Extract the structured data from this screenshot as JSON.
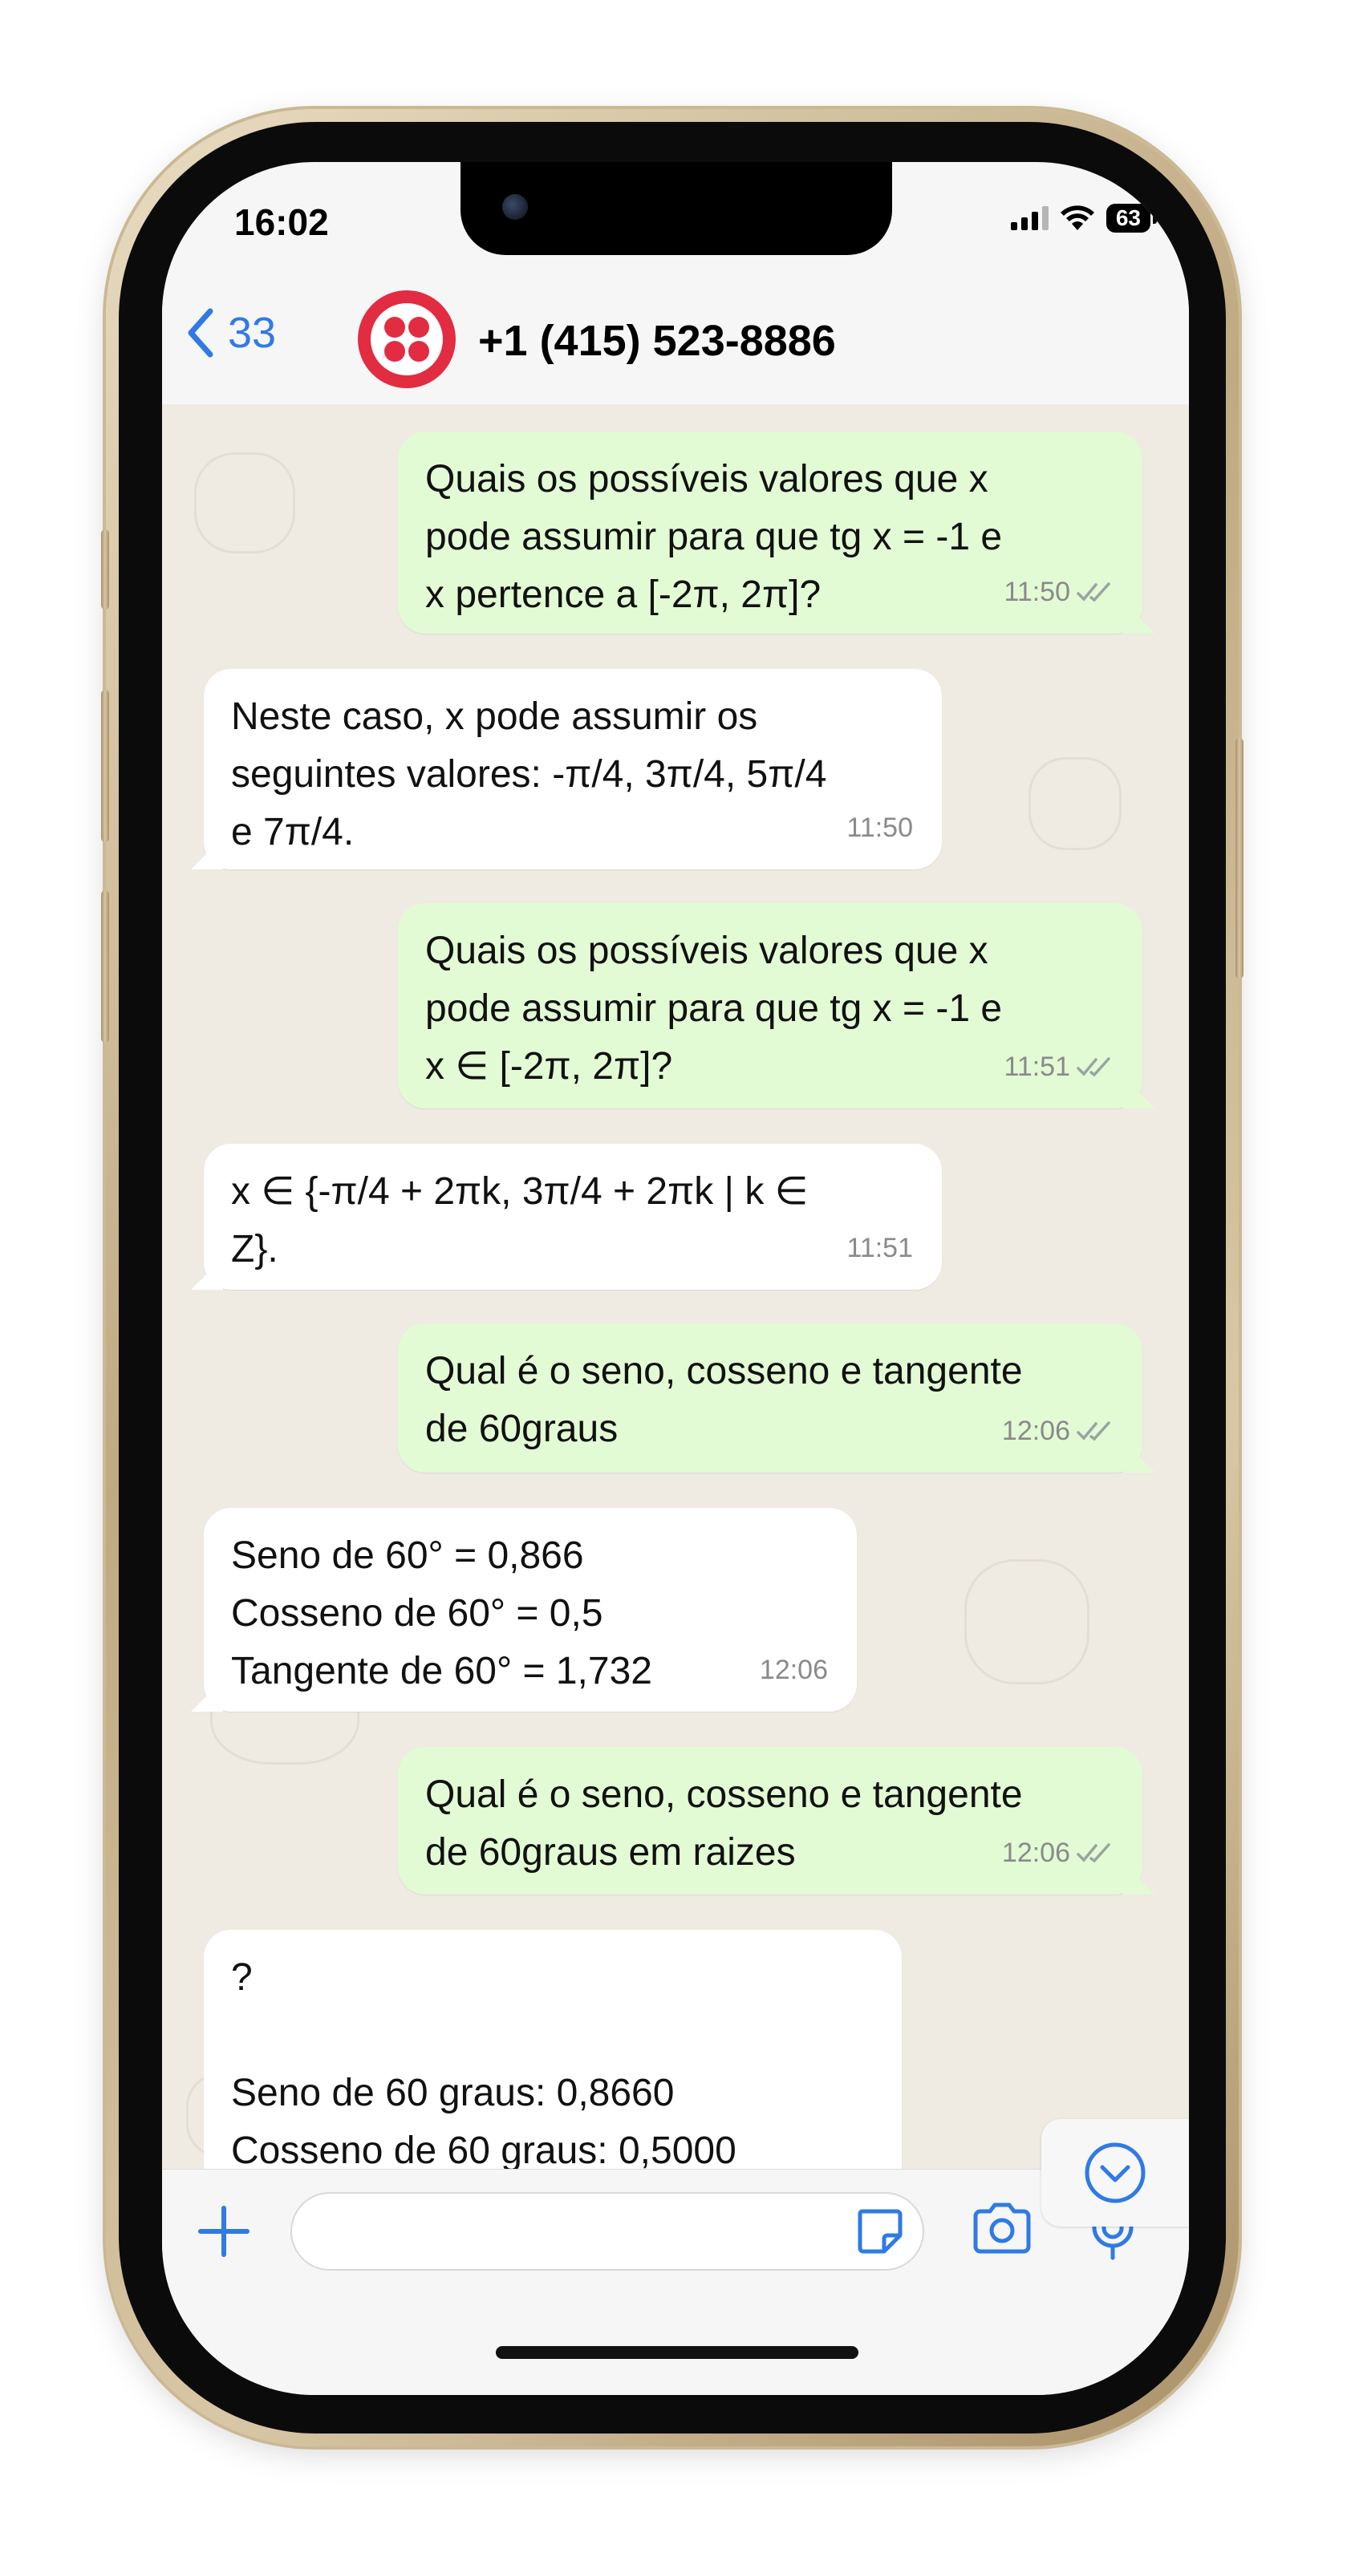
{
  "status_bar": {
    "time": "16:02",
    "battery": "63"
  },
  "header": {
    "back_count": "33",
    "contact_name": "+1 (415) 523-8886"
  },
  "messages": [
    {
      "dir": "out",
      "text": "Quais os possíveis valores que x\npode assumir para que tg x = -1 e\nx pertence a [-2π, 2π]?",
      "time": "11:50"
    },
    {
      "dir": "in",
      "text": "Neste caso, x pode assumir os\nseguintes valores: -π/4, 3π/4, 5π/4\ne 7π/4.",
      "time": "11:50"
    },
    {
      "dir": "out",
      "text": "Quais os possíveis valores que x\npode assumir para que tg x = -1 e\nx ∈ [-2π, 2π]?",
      "time": "11:51"
    },
    {
      "dir": "in",
      "text": "x ∈ {-π/4 + 2πk, 3π/4 + 2πk | k ∈\nZ}.",
      "time": "11:51"
    },
    {
      "dir": "out",
      "text": "Qual é o seno, cosseno e tangente\nde 60graus",
      "time": "12:06"
    },
    {
      "dir": "in",
      "text": "Seno de 60° = 0,866\nCosseno de 60° = 0,5\nTangente de 60° = 1,732",
      "time": "12:06"
    },
    {
      "dir": "out",
      "text": "Qual é o seno, cosseno e tangente\nde 60graus em raizes",
      "time": "12:06"
    },
    {
      "dir": "in",
      "text": "?\n\nSeno de 60 graus: 0,8660\nCosseno de 60 graus: 0,5000",
      "time": ""
    }
  ],
  "input": {
    "placeholder": ""
  },
  "icons": {
    "back": "chevron-left-icon",
    "read": "double-check-icon",
    "scroll": "chevron-down-circle-icon",
    "attach": "plus-icon",
    "sticker": "sticker-icon",
    "camera": "camera-icon",
    "mic": "microphone-icon"
  },
  "colors": {
    "accent": "#2f7ae5",
    "outgoing": "#e2fbd4",
    "incoming": "#ffffff",
    "chat_bg": "#efeae2",
    "avatar": "#e22c42"
  }
}
